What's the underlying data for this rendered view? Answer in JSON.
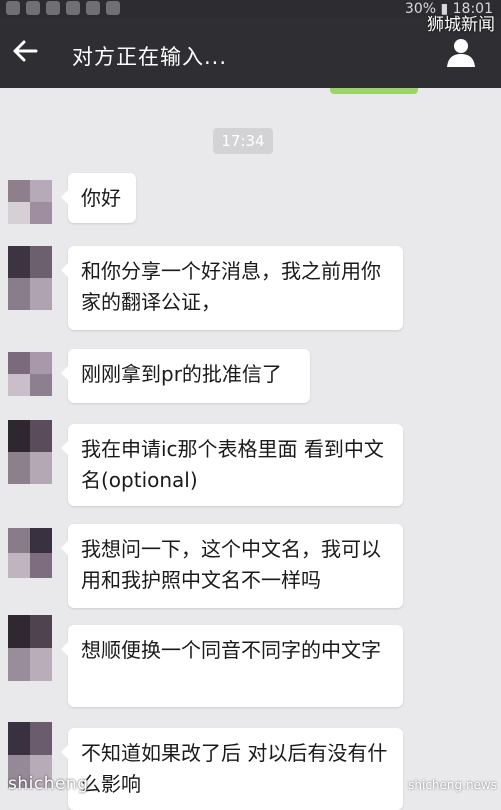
{
  "status_bar": {
    "right_text": "30% ▮ 18:01"
  },
  "watermarks": {
    "top_right": "狮城新闻",
    "bottom_left": "shicheng",
    "bottom_right": "shicheng.news"
  },
  "header": {
    "title": "对方正在输入...",
    "back_icon": "arrow-left-icon",
    "profile_icon": "person-icon"
  },
  "chat": {
    "timestamp": "17:34",
    "messages": [
      {
        "text": "你好"
      },
      {
        "text": "和你分享一个好消息，我之前用你家的翻译公证，"
      },
      {
        "text": "刚刚拿到pr的批准信了"
      },
      {
        "text": "我在申请ic那个表格里面 看到中文名(optional)"
      },
      {
        "text": "我想问一下，这个中文名，我可以用和我护照中文名不一样吗"
      },
      {
        "text": "想顺便换一个同音不同字的中文字"
      },
      {
        "text": "不知道如果改了后 对以后有没有什么影响"
      }
    ]
  },
  "colors": {
    "header_bg": "#2f2f33",
    "chat_bg": "#e9e9ec",
    "bubble_bg": "#ffffff",
    "sent_bubble": "#9bd56a"
  }
}
